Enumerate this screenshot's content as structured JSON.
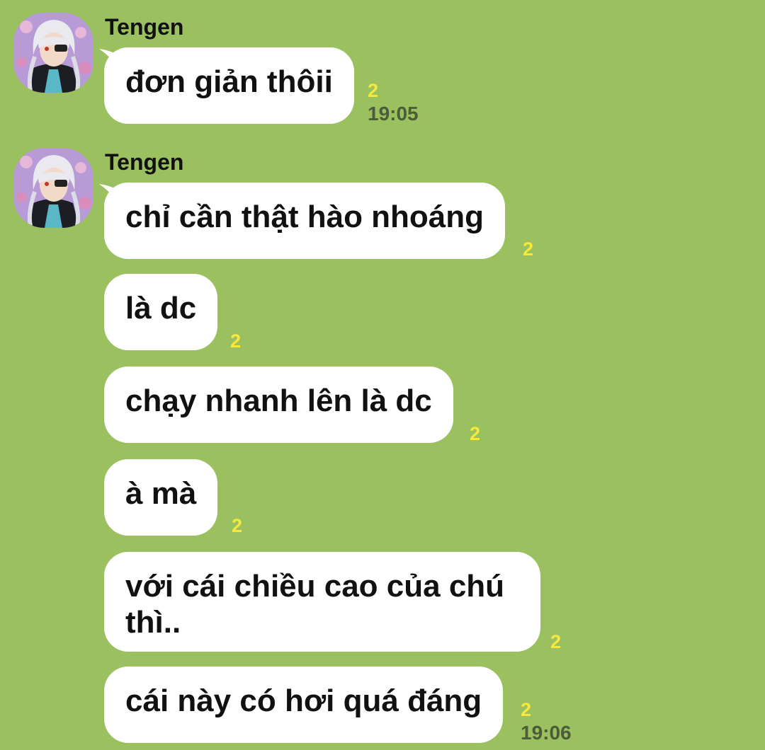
{
  "chat": {
    "groups": [
      {
        "sender": "Tengen",
        "messages": [
          {
            "text": "đơn giản thôii",
            "read_count": "2",
            "time": "19:05"
          }
        ]
      },
      {
        "sender": "Tengen",
        "messages": [
          {
            "text": "chỉ cần thật hào nhoáng",
            "read_count": "2"
          },
          {
            "text": "là dc",
            "read_count": "2"
          },
          {
            "text": "chạy nhanh lên là dc",
            "read_count": "2"
          },
          {
            "text": "à mà",
            "read_count": "2"
          },
          {
            "text": "với cái chiều cao của chú thì..",
            "read_count": "2"
          },
          {
            "text": "cái này có hơi quá đáng",
            "read_count": "2",
            "time": "19:06"
          }
        ]
      }
    ]
  },
  "colors": {
    "background": "#9bc060",
    "bubble": "#ffffff",
    "read_count": "#f6e93c",
    "time": "#4a5d38"
  },
  "icons": {
    "avatar": "tengen-avatar",
    "bubble_tail": "speech-tail"
  }
}
